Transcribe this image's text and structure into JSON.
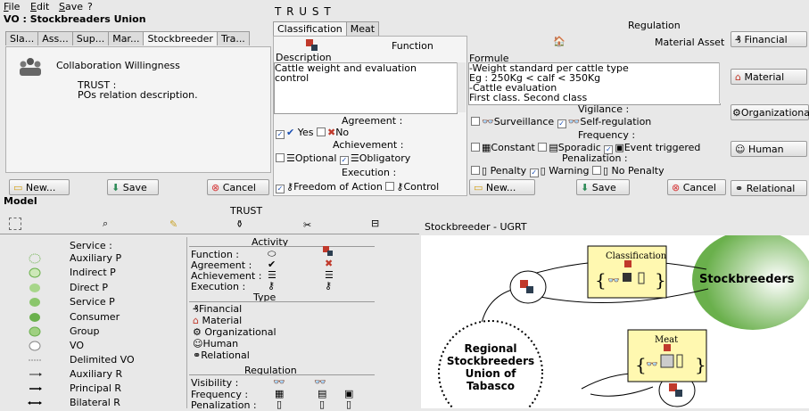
{
  "menu": [
    "File",
    "Edit",
    "Save",
    "?"
  ],
  "vo_title": "VO : Stockbreaders Union",
  "left_tabs": [
    "Sla...",
    "Ass...",
    "Sup...",
    "Mar...",
    "Stockbreeder",
    "Tra..."
  ],
  "left_panel": {
    "item": "Collaboration Willingness",
    "trust_title": "TRUST :",
    "trust_desc": "POs relation description."
  },
  "trust_header": "T R U S T",
  "center_tabs": [
    "Classification",
    "Meat"
  ],
  "function_label": "Function",
  "description_label": "Description",
  "description_text": "Cattle weight and evaluation\ncontrol",
  "agreement": {
    "label": "Agreement :",
    "yes": "Yes",
    "no": "No"
  },
  "achievement": {
    "label": "Achievement :",
    "optional": "Optional",
    "obligatory": "Obligatory"
  },
  "execution": {
    "label": "Execution :",
    "freedom": "Freedom of Action",
    "control": "Control"
  },
  "regulation_header": "Regulation",
  "material_asset_label": "Material Asset",
  "formule_label": "Formule",
  "formule_text": "-Weight standard per cattle type\nEg : 250Kg < calf < 350Kg\n-Cattle evaluation\nFirst class. Second class",
  "vigilance": {
    "label": "Vigilance :",
    "surveillance": "Surveillance",
    "self": "Self-regulation"
  },
  "frequency": {
    "label": "Frequency :",
    "constant": "Constant",
    "sporadic": "Sporadic",
    "event": "Event triggered"
  },
  "penalization": {
    "label": "Penalization :",
    "penalty": "Penalty",
    "warning": "Warning",
    "none": "No Penalty"
  },
  "asset_buttons": [
    "Financial",
    "Material",
    "Organizational",
    "Human",
    "Relational"
  ],
  "buttons": {
    "new": "New...",
    "save": "Save",
    "cancel": "Cancel"
  },
  "model_label": "Model",
  "trust_small": "TRUST",
  "legend": {
    "service_title": "Service :",
    "items": [
      "Auxiliary P",
      "Indirect P",
      "Direct P",
      "Service P",
      "Consumer",
      "Group",
      "VO",
      "Delimited VO",
      "Auxiliary R",
      "Principal R",
      "Bilateral R"
    ],
    "activity_title": "Activity",
    "activity_rows": [
      "Function :",
      "Agreement :",
      "Achievement :",
      "Execution :"
    ],
    "type_title": "Type",
    "type_items": [
      "Financial",
      "Material",
      "Organizational",
      "Human",
      "Relational"
    ],
    "regulation_title": "Regulation",
    "regulation_rows": [
      "Visibility :",
      "Frequency :",
      "Penalization :"
    ]
  },
  "diagram": {
    "title": "Stockbreeder - UGRT",
    "classification": "Classification",
    "stockbreeders": "Stockbreeders",
    "meat": "Meat",
    "regional": [
      "Regional",
      "Stockbreeders",
      "Union of",
      "Tabasco"
    ]
  },
  "colors": {
    "green": "#6ab04c",
    "note": "#fff8b0",
    "accent": "#1a4fb3"
  }
}
